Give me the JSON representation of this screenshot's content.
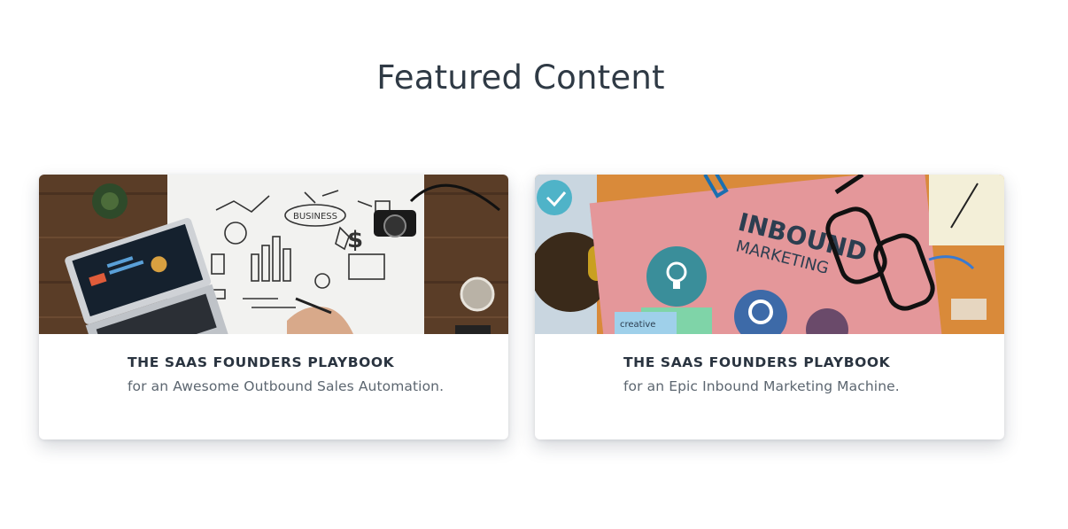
{
  "section": {
    "title": "Featured Content"
  },
  "cards": [
    {
      "heading": "THE SAAS FOUNDERS PLAYBOOK",
      "subtitle": "for an Awesome Outbound Sales Automation.",
      "image": {
        "hand_drawn_label": "BUSINESS"
      }
    },
    {
      "heading": "THE SAAS FOUNDERS PLAYBOOK",
      "subtitle": "for an Epic Inbound Marketing Machine.",
      "image": {
        "book_title_1": "INBOUND",
        "book_title_2": "MARKETING",
        "note": "creative"
      }
    }
  ]
}
